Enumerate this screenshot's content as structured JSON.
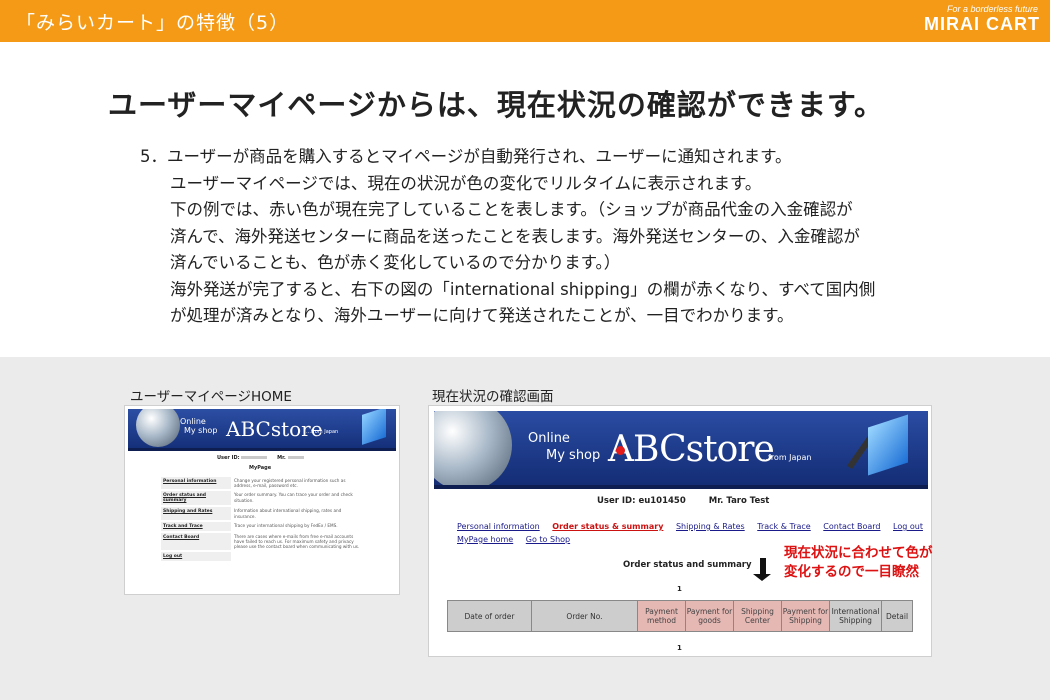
{
  "header": {
    "title": "「みらいカート」の特徴（5）",
    "brand_tagline": "For a borderless future",
    "brand_name": "MIRAI CART"
  },
  "headline": "ユーザーマイページからは、現在状況の確認ができます。",
  "paragraph": {
    "lines": [
      "5．ユーザーが商品を購入するとマイページが自動発行され、ユーザーに通知されます。",
      "ユーザーマイページでは、現在の状況が色の変化でリルタイムに表示されます。",
      "下の例では、赤い色が現在完了していることを表します。（ショップが商品代金の入金確認が",
      "済んで、海外発送センターに商品を送ったことを表します。海外発送センターの、入金確認が",
      "済んでいることも、色が赤く変化しているので分かります。）",
      "海外発送が完了すると、右下の図の「international shipping」の欄が赤くなり、すべて国内側",
      "が処理が済みとなり、海外ユーザーに向けて発送されたことが、一目でわかります。"
    ]
  },
  "captions": {
    "left": "ユーザーマイページHOME",
    "right": "現在状況の確認画面"
  },
  "small_shot": {
    "banner": {
      "line1": "Online",
      "line2": "My shop",
      "store": "ABCstore",
      "suffix": "…from Japan"
    },
    "user_label": "User ID:",
    "mr_label": "Mr.",
    "heading": "MyPage",
    "rows": [
      {
        "label": "Personal information",
        "desc": "Change your registered personal information such as address, e-mail, password etc."
      },
      {
        "label": "Order status and summary",
        "desc": "Your order summary. You can trace your order and check situation."
      },
      {
        "label": "Shipping and Rates",
        "desc": "Information about international shipping, rates and insurance."
      },
      {
        "label": "Track and Trace",
        "desc": "Trace your international shipping by FedEx / EMS."
      },
      {
        "label": "Contact Board",
        "desc": "There are cases where e-mails from free e-mail accounts have failed to reach us. For maximum safety and privacy please use the contact board when communicating with us."
      },
      {
        "label": "Log out",
        "desc": ""
      }
    ]
  },
  "large_shot": {
    "banner": {
      "line1": "Online",
      "line2": "My shop",
      "store": "ABCstore",
      "suffix": "…from Japan"
    },
    "user_id": "User ID: eu101450",
    "user_name": "Mr. Taro Test",
    "nav": [
      {
        "label": "Personal information",
        "active": false
      },
      {
        "label": "Order status & summary",
        "active": true
      },
      {
        "label": "Shipping & Rates",
        "active": false
      },
      {
        "label": "Track & Trace",
        "active": false
      },
      {
        "label": "Contact Board",
        "active": false
      },
      {
        "label": "Log out",
        "active": false
      }
    ],
    "nav2": [
      {
        "label": "MyPage home"
      },
      {
        "label": "Go to Shop"
      }
    ],
    "section_title": "Order status and summary",
    "page_number": "1",
    "columns": [
      {
        "label": "Date of order",
        "done": false
      },
      {
        "label": "Order No.",
        "done": false
      },
      {
        "label": "Payment method",
        "done": true
      },
      {
        "label": "Payment for goods",
        "done": true
      },
      {
        "label": "Shipping Center",
        "done": true
      },
      {
        "label": "Payment for Shipping",
        "done": true
      },
      {
        "label": "International Shipping",
        "done": false
      },
      {
        "label": "Detail",
        "done": false
      }
    ]
  },
  "annotation": {
    "line1": "現在状況に合わせて色が",
    "line2": "変化するので一目瞭然",
    "color": "#dd1111"
  },
  "colors": {
    "header_orange": "#f49a16",
    "done_cell": "#e5b8b4",
    "pending_cell": "#cdcdcd",
    "banner_blue": "#1e3d8f"
  }
}
